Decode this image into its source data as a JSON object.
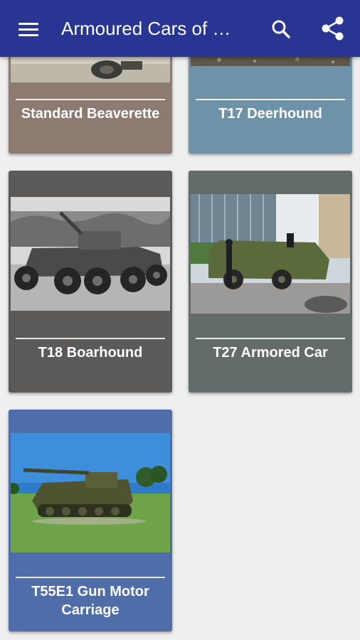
{
  "toolbar": {
    "title": "Armoured Cars of World War II",
    "menu_icon": "hamburger-menu-icon",
    "search_icon": "search-icon",
    "share_icon": "share-icon",
    "color": "#283593"
  },
  "cards": [
    {
      "name": "Standard Beaverette",
      "color": "#8d7b71"
    },
    {
      "name": "T17 Deerhound",
      "color": "#6e93a8"
    },
    {
      "name": "T18 Boarhound",
      "color": "#5c5959"
    },
    {
      "name": "T27 Armored Car",
      "color": "#646b6b"
    },
    {
      "name": "T55E1 Gun Motor Carriage",
      "color": "#4f6ea9"
    }
  ]
}
